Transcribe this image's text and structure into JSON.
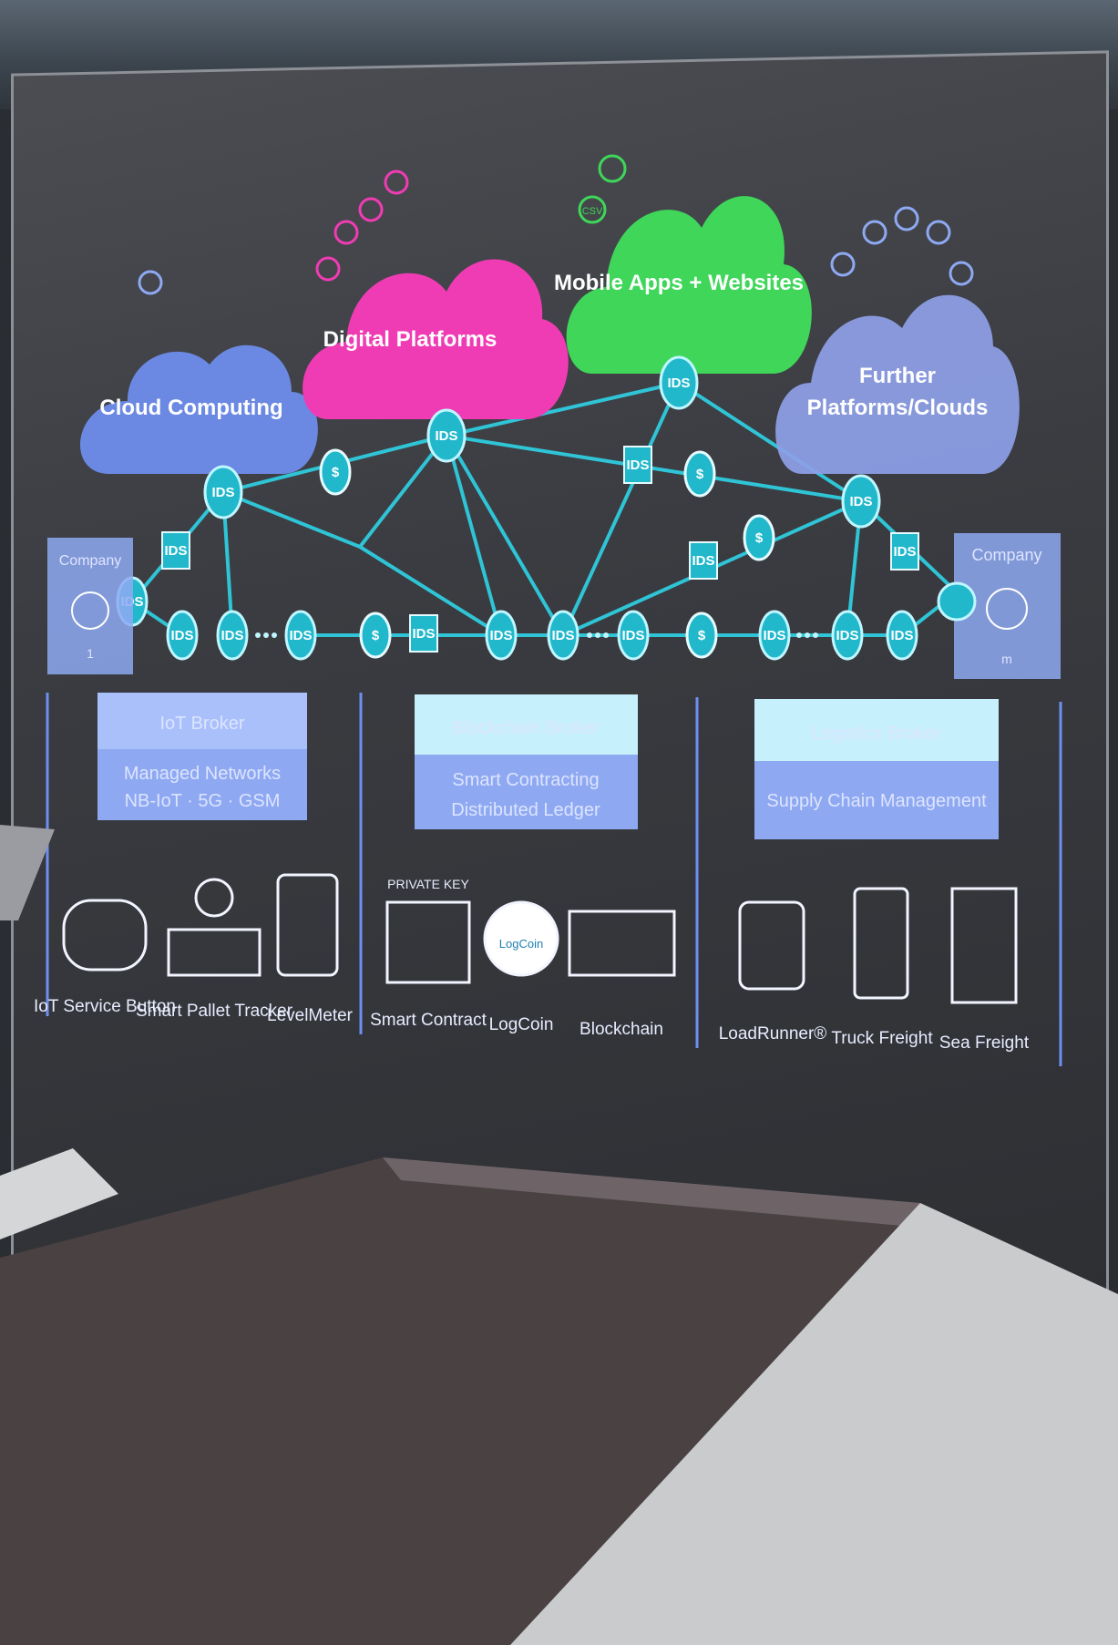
{
  "clouds": {
    "cloud_computing": "Cloud Computing",
    "digital_platforms": "Digital Platforms",
    "mobile_apps": "Mobile Apps + Websites",
    "further_line1": "Further",
    "further_line2": "Platforms/Clouds"
  },
  "node_label": "IDS",
  "coin_label": "$",
  "csv_label": "CSV",
  "company_left": "Company",
  "company_right": "Company",
  "company_left_sub": "1",
  "company_right_sub": "m",
  "brokers": {
    "iot": {
      "title": "IoT Broker",
      "line1": "Managed Networks",
      "line2": "NB-IoT · 5G · GSM"
    },
    "blockchain": {
      "title": "Blockchain Broker",
      "line1": "Smart Contracting",
      "line2": "Distributed Ledger"
    },
    "logistics": {
      "title": "Logistics Broker",
      "line1": "Supply Chain Management"
    }
  },
  "devices": {
    "iot_service_button": "IoT Service Button",
    "smart_pallet_tracker": "Smart Pallet Tracker",
    "level_meter": "LevelMeter",
    "private_key": "PRIVATE KEY",
    "smart_contract": "Smart Contract",
    "logcoin": "LogCoin",
    "logcoin_inner": "LogCoin",
    "blockchain": "Blockchain",
    "loadrunner": "LoadRunner®",
    "truck_freight": "Truck Freight",
    "sea_freight": "Sea Freight"
  },
  "colors": {
    "cloud_blue": "#6f8ff0",
    "cloud_magenta": "#f03cb4",
    "cloud_green": "#3fd65a",
    "cloud_lavender": "#8e9fe8",
    "node_cyan": "#22b8cc",
    "line_cyan": "#2fc4d6",
    "box_blue": "#8ea9f2"
  }
}
